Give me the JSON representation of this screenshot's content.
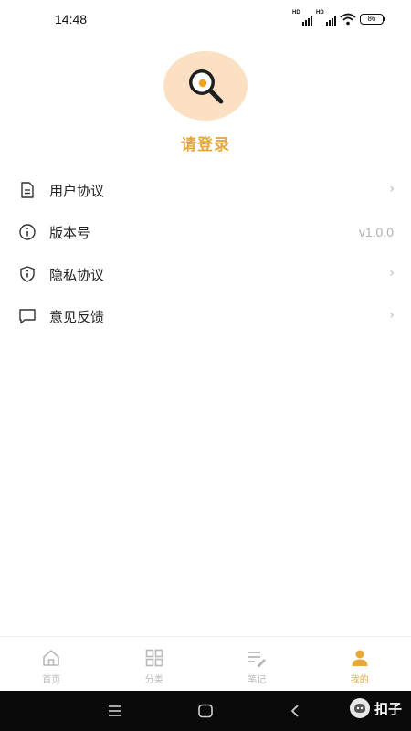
{
  "status_bar": {
    "time": "14:48",
    "sim1_label": "HD",
    "sim2_label": "HD",
    "battery": "86"
  },
  "profile": {
    "avatar_icon": "frying-pan-egg-icon",
    "login_text": "请登录"
  },
  "menu": [
    {
      "icon": "document-icon",
      "label": "用户协议",
      "value": "",
      "chevron": "›"
    },
    {
      "icon": "info-icon",
      "label": "版本号",
      "value": "v1.0.0",
      "chevron": ""
    },
    {
      "icon": "shield-info-icon",
      "label": "隐私协议",
      "value": "",
      "chevron": "›"
    },
    {
      "icon": "chat-bubble-icon",
      "label": "意见反馈",
      "value": "",
      "chevron": "›"
    }
  ],
  "tabs": [
    {
      "icon": "home-icon",
      "label": "首页",
      "active": false
    },
    {
      "icon": "grid-icon",
      "label": "分类",
      "active": false
    },
    {
      "icon": "notes-icon",
      "label": "笔记",
      "active": false
    },
    {
      "icon": "person-icon",
      "label": "我的",
      "active": true
    }
  ],
  "nav_bar": {
    "buttons": [
      "menu-icon",
      "home-square-icon",
      "back-icon"
    ],
    "watermark_text": "扣子"
  },
  "colors": {
    "accent": "#e7a93c",
    "avatar_bg": "#fbe0c3",
    "inactive": "#b8b8b8"
  }
}
